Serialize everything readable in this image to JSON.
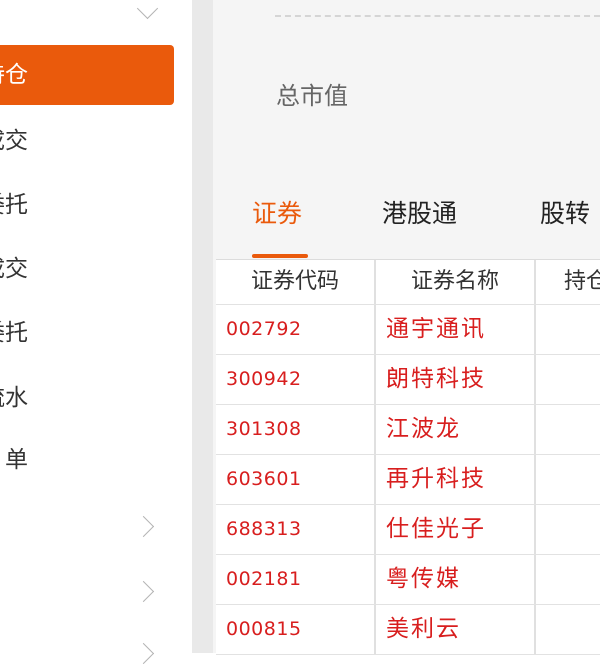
{
  "sidebar": {
    "items": [
      {
        "label": "持仓",
        "active": true
      },
      {
        "label": "成交"
      },
      {
        "label": "委托"
      },
      {
        "label": "成交"
      },
      {
        "label": "委托"
      },
      {
        "label": "流水"
      },
      {
        "label": "单"
      }
    ]
  },
  "main": {
    "total_market_value_label": "总市值",
    "tabs": [
      {
        "label": "证券",
        "active": true
      },
      {
        "label": "港股通"
      },
      {
        "label": "股转"
      }
    ],
    "table": {
      "columns": [
        "证券代码",
        "证券名称",
        "持仓"
      ],
      "rows": [
        {
          "code": "002792",
          "name": "通宇通讯"
        },
        {
          "code": "300942",
          "name": "朗特科技"
        },
        {
          "code": "301308",
          "name": "江波龙"
        },
        {
          "code": "603601",
          "name": "再升科技"
        },
        {
          "code": "688313",
          "name": "仕佳光子"
        },
        {
          "code": "002181",
          "name": "粤传媒"
        },
        {
          "code": "000815",
          "name": "美利云"
        }
      ]
    }
  },
  "colors": {
    "accent": "#ea5a0c",
    "stock_text": "#d81e1e"
  }
}
